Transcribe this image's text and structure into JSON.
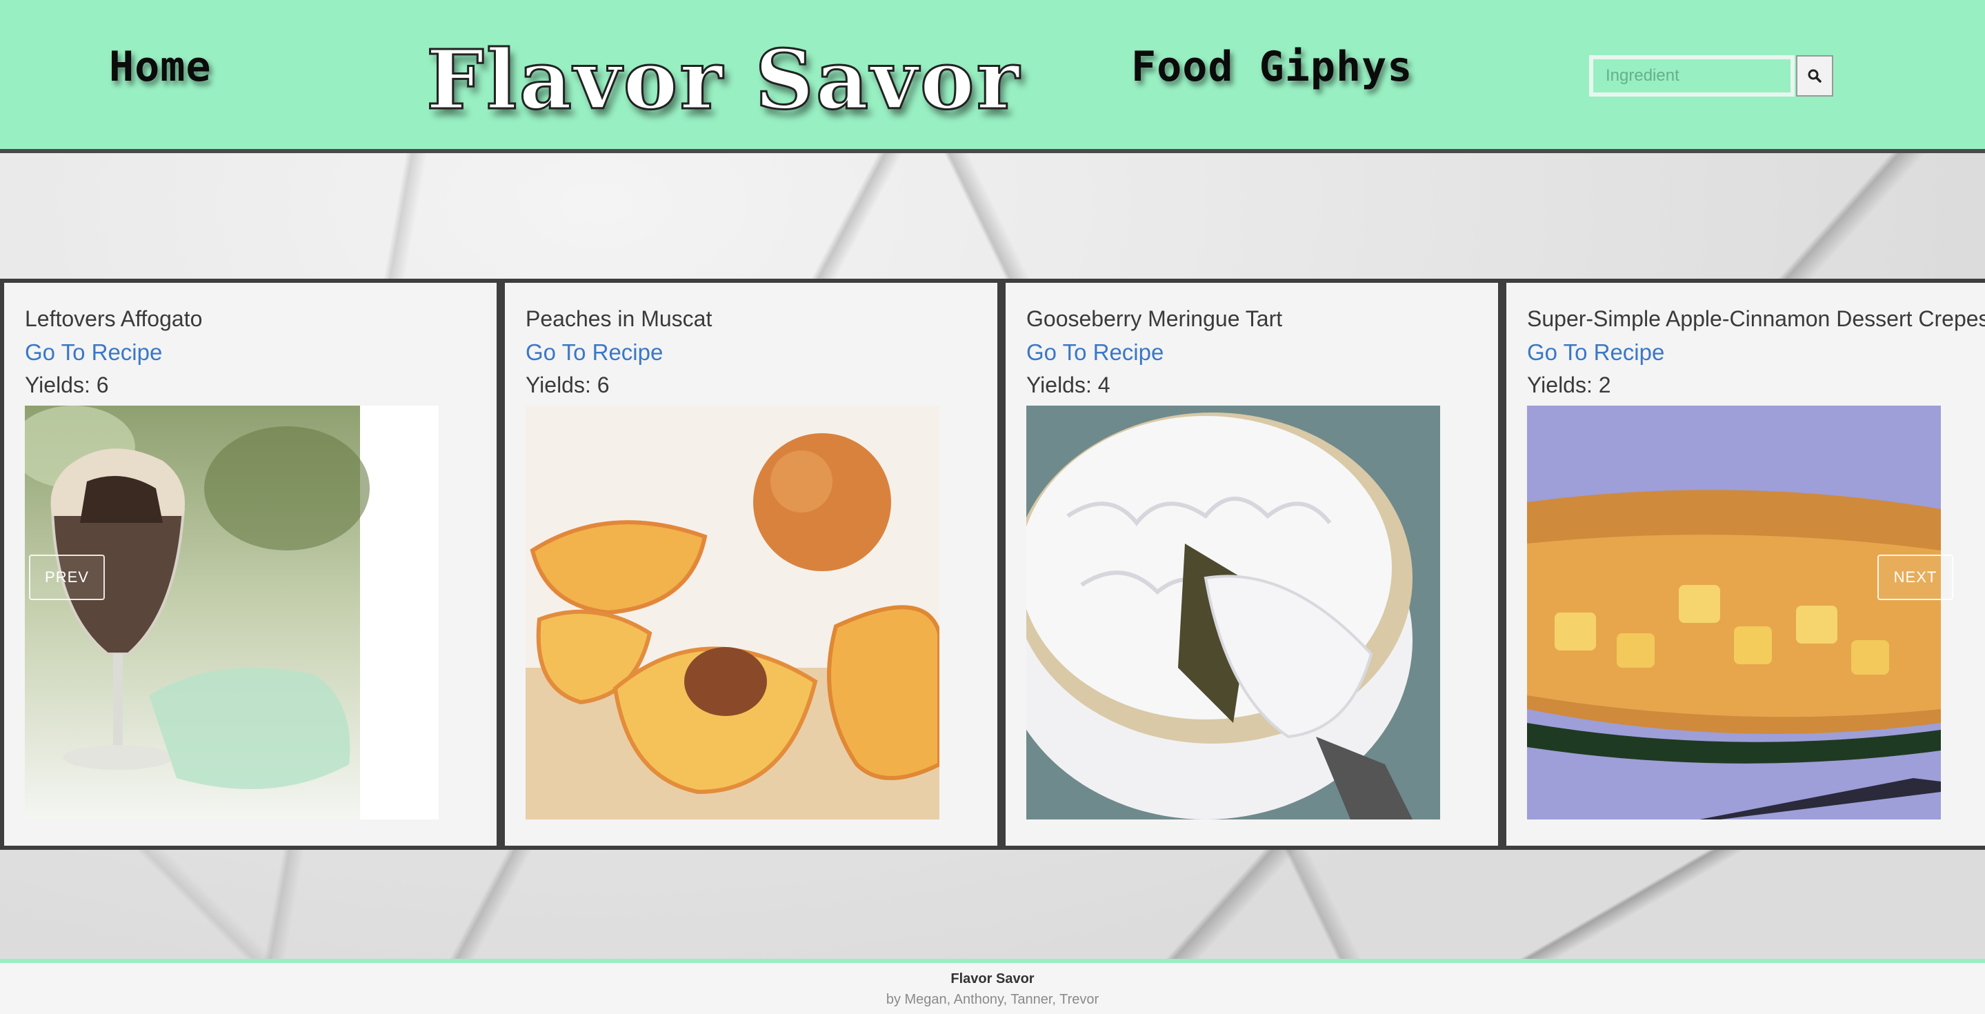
{
  "header": {
    "home_label": "Home",
    "brand": "Flavor Savor",
    "giphys_label": "Food Giphys",
    "search": {
      "placeholder": "Ingredient",
      "value": "",
      "button_icon": "search-icon"
    },
    "background_color": "#98efc2"
  },
  "carousel": {
    "prev_label": "PREV",
    "next_label": "NEXT",
    "cards": [
      {
        "title": "Leftovers Affogato",
        "link_label": "Go To Recipe",
        "yields": "Yields: 6",
        "image": "affogato-photo"
      },
      {
        "title": "Peaches in Muscat",
        "link_label": "Go To Recipe",
        "yields": "Yields: 6",
        "image": "peaches-photo"
      },
      {
        "title": "Gooseberry Meringue Tart",
        "link_label": "Go To Recipe",
        "yields": "Yields: 4",
        "image": "meringue-tart-photo"
      },
      {
        "title": "Super-Simple Apple-Cinnamon Dessert Crepes",
        "link_label": "Go To Recipe",
        "yields": "Yields: 2",
        "image": "apple-crepe-photo"
      }
    ]
  },
  "footer": {
    "title": "Flavor Savor",
    "credits": "by Megan, Anthony, Tanner, Trevor"
  },
  "colors": {
    "accent": "#98efc2",
    "link": "#3a78c8",
    "border": "#3e3e3e"
  }
}
